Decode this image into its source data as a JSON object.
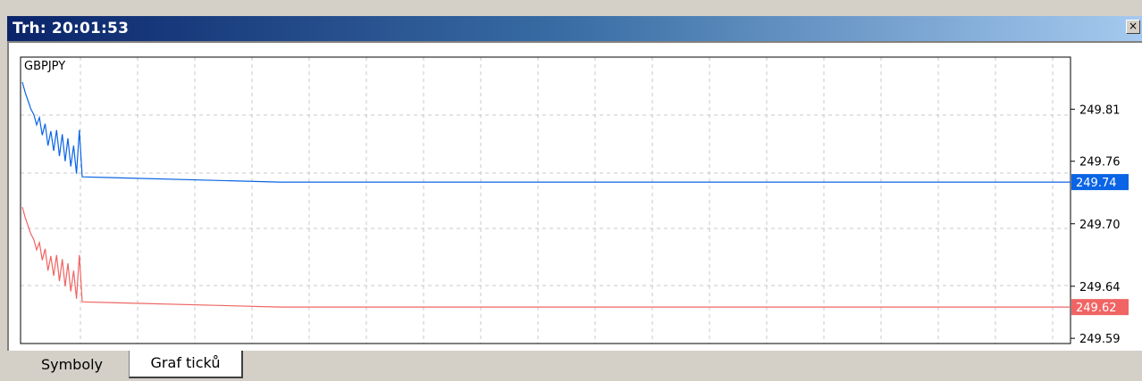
{
  "window": {
    "title": "Trh: 20:01:53",
    "close_glyph": "×"
  },
  "tabs": [
    {
      "label": "Symboly",
      "active": false
    },
    {
      "label": "Graf ticků",
      "active": true
    }
  ],
  "chart_data": {
    "type": "line",
    "symbol": "GBPJPY",
    "y_ticks": [
      "249.81",
      "249.76",
      "249.70",
      "249.64",
      "249.59"
    ],
    "ylim": [
      249.585,
      249.86
    ],
    "grid": true,
    "series": [
      {
        "color": "#0a64e6",
        "current_label": "249.74",
        "current": 249.74,
        "values": [
          249.836,
          249.826,
          249.818,
          249.81,
          249.805,
          249.795,
          249.802,
          249.785,
          249.796,
          249.775,
          249.789,
          249.77,
          249.79,
          249.765,
          249.786,
          249.76,
          249.782,
          249.755,
          249.775,
          249.748,
          249.79,
          249.745,
          249.74,
          249.74,
          249.74,
          249.74,
          249.74
        ]
      },
      {
        "color": "#f06464",
        "current_label": "249.62",
        "current": 249.62,
        "values": [
          249.716,
          249.706,
          249.698,
          249.69,
          249.685,
          249.675,
          249.682,
          249.665,
          249.676,
          249.655,
          249.669,
          249.65,
          249.67,
          249.645,
          249.666,
          249.64,
          249.662,
          249.635,
          249.655,
          249.628,
          249.67,
          249.625,
          249.62,
          249.62,
          249.62,
          249.62,
          249.62
        ]
      }
    ]
  }
}
